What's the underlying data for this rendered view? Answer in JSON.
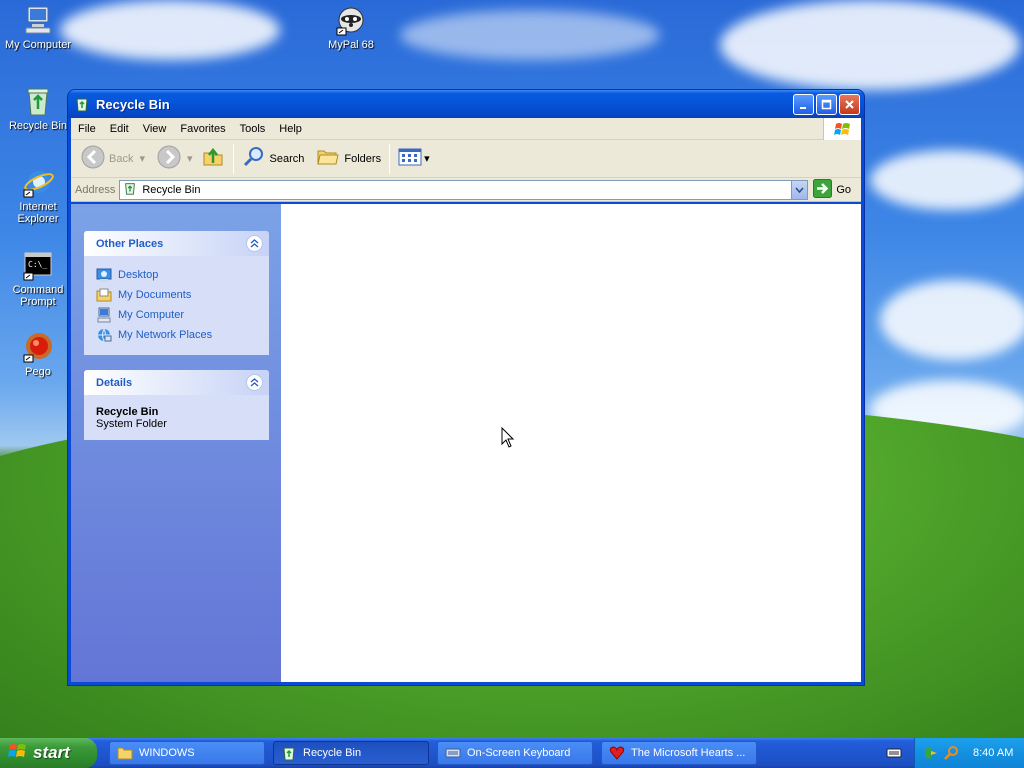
{
  "desktop": {
    "icons": [
      {
        "label": "My Computer"
      },
      {
        "label": "MyPal 68"
      },
      {
        "label": "Recycle Bin"
      },
      {
        "label_line1": "Internet",
        "label_line2": "Explorer"
      },
      {
        "label_line1": "Command",
        "label_line2": "Prompt"
      },
      {
        "label": "Pego"
      }
    ]
  },
  "window": {
    "title": "Recycle Bin",
    "menu": [
      "File",
      "Edit",
      "View",
      "Favorites",
      "Tools",
      "Help"
    ],
    "toolbar": {
      "back": "Back",
      "search": "Search",
      "folders": "Folders"
    },
    "address": {
      "label": "Address",
      "value": "Recycle Bin",
      "go": "Go"
    },
    "taskpane": {
      "other_places": {
        "title": "Other Places",
        "links": [
          "Desktop",
          "My Documents",
          "My Computer",
          "My Network Places"
        ]
      },
      "details": {
        "title": "Details",
        "name": "Recycle Bin",
        "type": "System Folder"
      }
    }
  },
  "taskbar": {
    "start": "start",
    "tasks": [
      "WINDOWS",
      "Recycle Bin",
      "On-Screen Keyboard",
      "The Microsoft Hearts ..."
    ],
    "clock": "8:40 AM"
  },
  "colors": {
    "titlebar": "#0553d8",
    "taskpane_link": "#215dc6",
    "start_button": "#3c9a3a"
  }
}
